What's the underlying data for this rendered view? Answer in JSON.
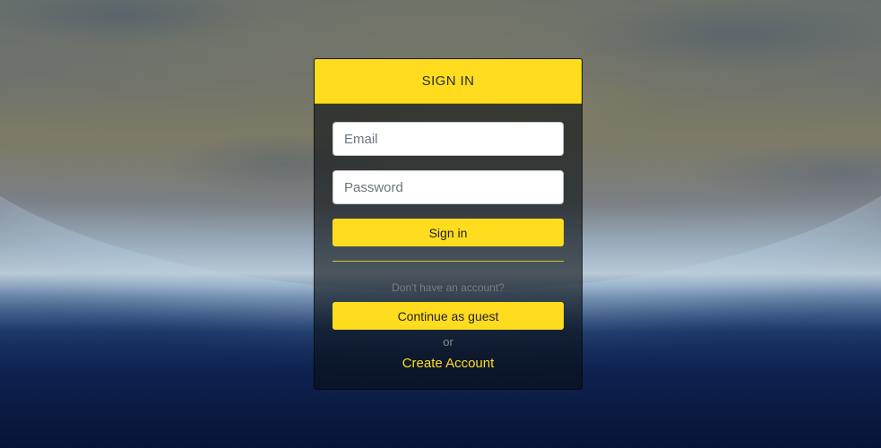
{
  "login": {
    "title": "SIGN IN",
    "email_placeholder": "Email",
    "password_placeholder": "Password",
    "signin_button": "Sign in",
    "no_account_text": "Don't have an account?",
    "guest_button": "Continue as guest",
    "or_text": "or",
    "create_account_link": "Create Account"
  },
  "colors": {
    "accent": "#ffdd1e",
    "panel": "rgba(10,14,20,0.62)"
  }
}
